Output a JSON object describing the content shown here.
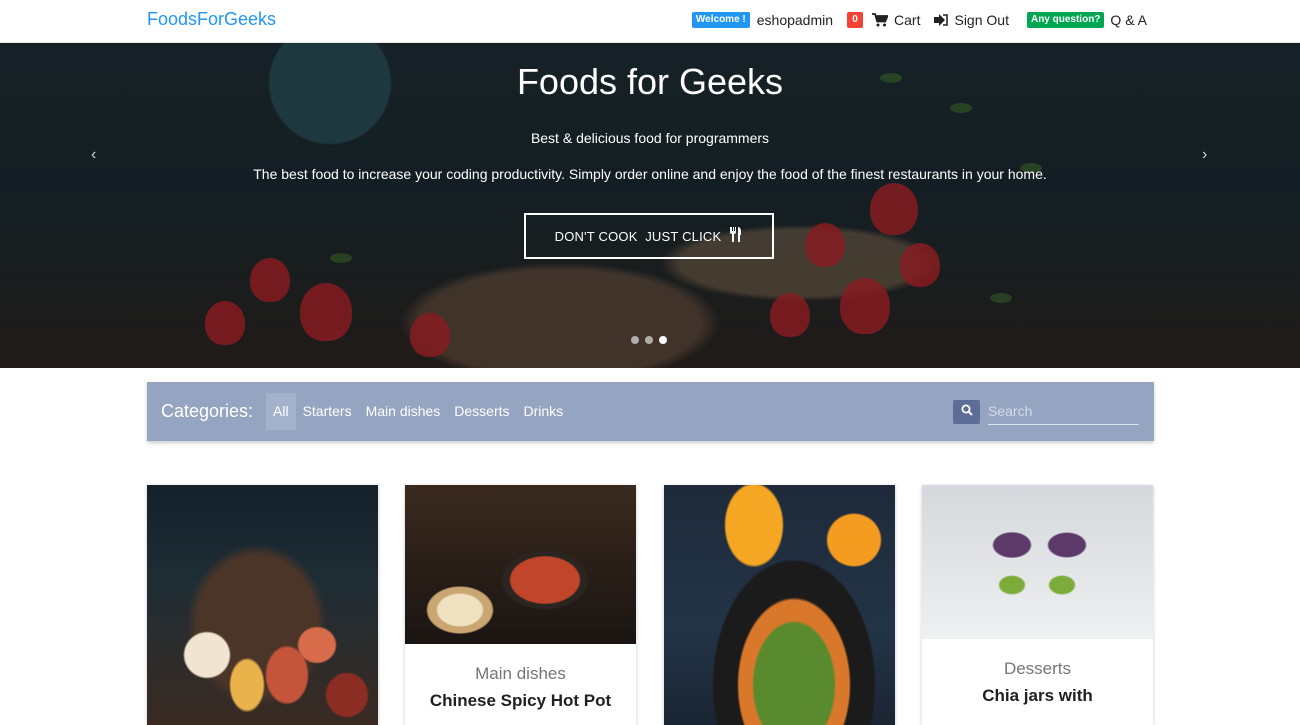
{
  "navbar": {
    "brand": "FoodsForGeeks",
    "welcome_badge": "Welcome !",
    "username": "eshopadmin",
    "cart_count": "0",
    "cart_label": "Cart",
    "signout_label": "Sign Out",
    "question_badge": "Any question?",
    "qa_label": "Q & A"
  },
  "hero": {
    "title": "Foods for Geeks",
    "subtitle": "Best & delicious food for programmers",
    "description": "The best food to increase your coding productivity. Simply order online and enjoy the food of the finest restaurants in your home.",
    "cta_label": "DON'T COOK  JUST CLICK",
    "prev_arrow": "‹",
    "next_arrow": "›",
    "slide_count": 3,
    "active_slide": 2
  },
  "categories": {
    "label": "Categories:",
    "items": [
      "All",
      "Starters",
      "Main dishes",
      "Desserts",
      "Drinks"
    ],
    "active": "All",
    "search_placeholder": "Search"
  },
  "cards": [
    {
      "category": "",
      "title": ""
    },
    {
      "category": "Main dishes",
      "title": "Chinese Spicy Hot Pot"
    },
    {
      "category": "",
      "title": ""
    },
    {
      "category": "Desserts",
      "title": "Chia jars with"
    }
  ],
  "colors": {
    "brand": "#2196f3",
    "category_bar": "#95a4c0",
    "search_button": "#5c6d96",
    "badge_welcome": "#2196f3",
    "badge_cart": "#f44336",
    "badge_question": "#00a651"
  }
}
